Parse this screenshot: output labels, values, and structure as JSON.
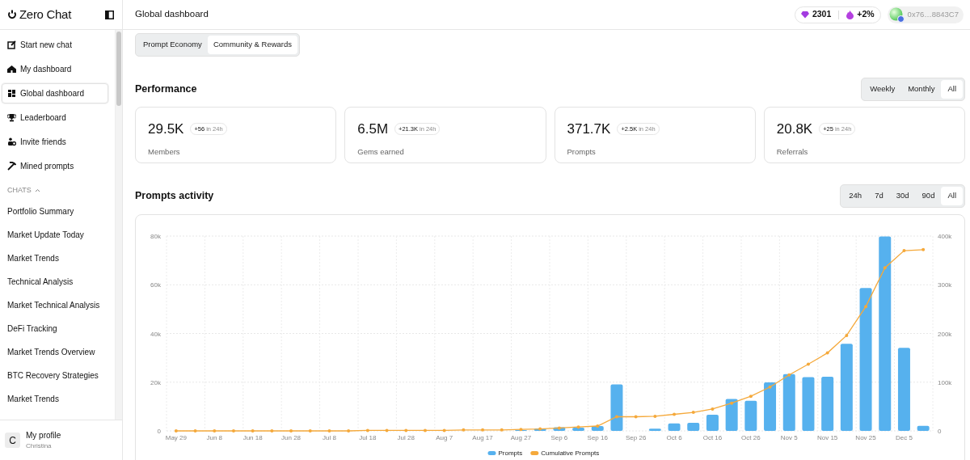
{
  "sidebar": {
    "brand": "Zero Chat",
    "nav": [
      {
        "label": "Start new chat",
        "kind": "compose",
        "selected": false
      },
      {
        "label": "My dashboard",
        "kind": "home",
        "selected": false
      },
      {
        "label": "Global dashboard",
        "kind": "grid",
        "selected": true
      },
      {
        "label": "Leaderboard",
        "kind": "trophy",
        "selected": false
      },
      {
        "label": "Invite friends",
        "kind": "people",
        "selected": false
      },
      {
        "label": "Mined prompts",
        "kind": "pick",
        "selected": false
      }
    ],
    "chats_heading": "CHATS",
    "chats_expanded": true,
    "chats": [
      "Portfolio Summary",
      "Market Update Today",
      "Market Trends",
      "Technical Analysis",
      "Market Technical Analysis",
      "DeFi Tracking",
      "Market Trends Overview",
      "BTC Recovery Strategies",
      "Market Trends"
    ],
    "profile": {
      "initial": "C",
      "title": "My profile",
      "subtitle": "Christina"
    }
  },
  "header": {
    "title": "Global dashboard",
    "gems": "2301",
    "boost": "+2%",
    "wallet": "0x76…8843C7"
  },
  "tabs": [
    {
      "label": "Prompt Economy",
      "selected": false
    },
    {
      "label": "Community & Rewards",
      "selected": true
    }
  ],
  "performance": {
    "title": "Performance",
    "periods": [
      {
        "label": "Weekly",
        "selected": false
      },
      {
        "label": "Monthly",
        "selected": false
      },
      {
        "label": "All",
        "selected": true
      }
    ],
    "stats": [
      {
        "value": "29.5K",
        "delta": "+56",
        "delta_suffix": "in 24h",
        "label": "Members"
      },
      {
        "value": "6.5M",
        "delta": "+21.3K",
        "delta_suffix": "in 24h",
        "label": "Gems earned"
      },
      {
        "value": "371.7K",
        "delta": "+2.5K",
        "delta_suffix": "in 24h",
        "label": "Prompts"
      },
      {
        "value": "20.8K",
        "delta": "+25",
        "delta_suffix": "in 24h",
        "label": "Referrals"
      }
    ]
  },
  "activity": {
    "title": "Prompts activity",
    "ranges": [
      {
        "label": "24h",
        "selected": false
      },
      {
        "label": "7d",
        "selected": false
      },
      {
        "label": "30d",
        "selected": false
      },
      {
        "label": "90d",
        "selected": false
      },
      {
        "label": "All",
        "selected": true
      }
    ],
    "chart_data": {
      "type": "bar",
      "categories": [
        "May 29",
        null,
        "Jun 8",
        null,
        "Jun 18",
        null,
        "Jun 28",
        null,
        "Jul 8",
        null,
        "Jul 18",
        null,
        "Jul 28",
        null,
        "Aug 7",
        null,
        "Aug 17",
        null,
        "Aug 27",
        null,
        "Sep 6",
        null,
        "Sep 16",
        null,
        "Sep 26",
        null,
        "Oct 6",
        null,
        "Oct 16",
        null,
        "Oct 26",
        null,
        "Nov 5",
        null,
        "Nov 15",
        null,
        "Nov 25",
        null,
        "Dec 5",
        null
      ],
      "grid": true,
      "legend": "bottom",
      "ylim": [
        0,
        80000
      ],
      "yticks": [
        {
          "value": 0,
          "label": "0"
        },
        {
          "value": 20000,
          "label": "20k"
        },
        {
          "value": 40000,
          "label": "40k"
        },
        {
          "value": 60000,
          "label": "60k"
        },
        {
          "value": 80000,
          "label": "80k"
        }
      ],
      "y2lim": [
        0,
        400000
      ],
      "y2ticks": [
        {
          "value": 0,
          "label": "0"
        },
        {
          "value": 100000,
          "label": "100k"
        },
        {
          "value": 200000,
          "label": "200k"
        },
        {
          "value": 300000,
          "label": "300k"
        },
        {
          "value": 400000,
          "label": "400k"
        }
      ],
      "series": [
        {
          "name": "Prompts",
          "color": "#56b1ee",
          "type": "bar",
          "values": [
            0,
            0,
            0,
            0,
            0,
            0,
            0,
            0,
            0,
            0,
            0,
            0,
            0,
            0,
            0,
            0,
            0,
            0,
            300,
            1000,
            1500,
            1300,
            2000,
            19100,
            0,
            900,
            3100,
            3300,
            6600,
            13100,
            12400,
            19900,
            23300,
            22100,
            22200,
            35800,
            58700,
            79800,
            34100,
            2100
          ]
        },
        {
          "name": "Cumulative Prompts",
          "color": "#f5a93b",
          "type": "line",
          "axis": "y2",
          "values": [
            0,
            0,
            0,
            0,
            0,
            0,
            0,
            0,
            0,
            0,
            1000,
            1000,
            1000,
            1000,
            1000,
            2000,
            2000,
            2000,
            3000,
            4000,
            6000,
            8000,
            10000,
            29000,
            29000,
            30000,
            34000,
            38000,
            45000,
            57000,
            71000,
            90000,
            115000,
            137000,
            160000,
            196000,
            255000,
            335000,
            370000,
            372000
          ]
        }
      ]
    }
  }
}
